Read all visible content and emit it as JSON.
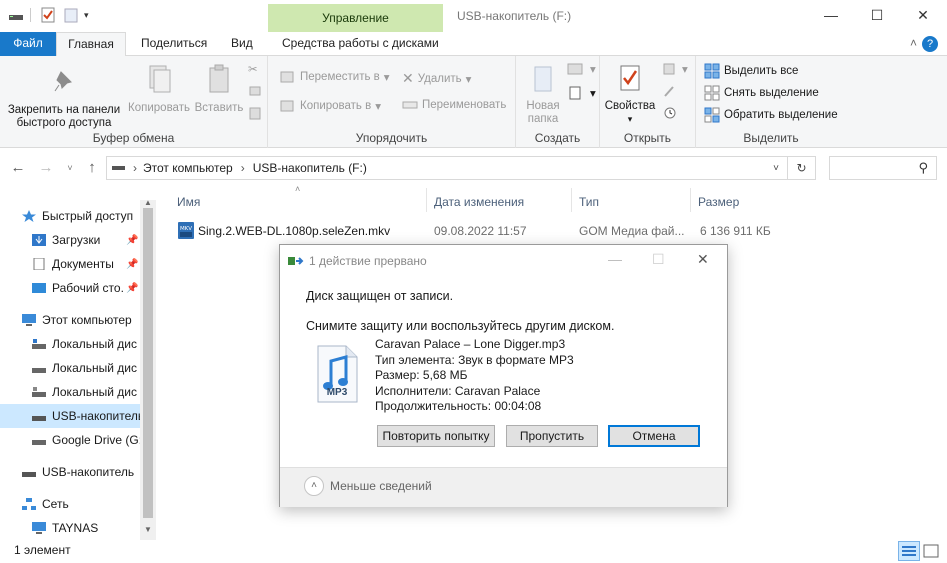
{
  "titlebar": {
    "context_tab_header": "Управление",
    "window_title": "USB-накопитель (F:)",
    "minimize": "—",
    "maximize": "☐",
    "close": "✕"
  },
  "tabs": {
    "file": "Файл",
    "home": "Главная",
    "share": "Поделиться",
    "view": "Вид",
    "drive_tools": "Средства работы с дисками",
    "collapse": "˄",
    "help": "?"
  },
  "ribbon": {
    "clipboard": {
      "pin_label": "Закрепить на панели быстрого доступа",
      "pin_line1": "Закрепить на панели",
      "pin_line2": "быстрого доступа",
      "copy": "Копировать",
      "paste": "Вставить",
      "group": "Буфер обмена"
    },
    "organize": {
      "move_to": "Переместить в",
      "copy_to": "Копировать в",
      "delete": "Удалить",
      "rename": "Переименовать",
      "group": "Упорядочить"
    },
    "new": {
      "new_folder_line1": "Новая",
      "new_folder_line2": "папка",
      "group": "Создать"
    },
    "open": {
      "properties": "Свойства",
      "group": "Открыть"
    },
    "select": {
      "select_all": "Выделить все",
      "select_none": "Снять выделение",
      "invert": "Обратить выделение",
      "group": "Выделить"
    }
  },
  "address": {
    "crumb_pc": "Этот компьютер",
    "crumb_sep": "›",
    "crumb_drive": "USB-накопитель (F:)",
    "search_placeholder": ""
  },
  "nav": {
    "items": [
      {
        "label": "Быстрый доступ"
      },
      {
        "label": "Загрузки"
      },
      {
        "label": "Документы"
      },
      {
        "label": "Рабочий сто."
      },
      {
        "label": "Этот компьютер"
      },
      {
        "label": "Локальный дис"
      },
      {
        "label": "Локальный дис"
      },
      {
        "label": "Локальный дис"
      },
      {
        "label": "USB-накопитель"
      },
      {
        "label": "Google Drive (G:"
      },
      {
        "label": "USB-накопитель"
      },
      {
        "label": "Сеть"
      },
      {
        "label": "TAYNAS"
      }
    ]
  },
  "filelist": {
    "columns": [
      "Имя",
      "Дата изменения",
      "Тип",
      "Размер"
    ],
    "rows": [
      {
        "name": "Sing.2.WEB-DL.1080p.seleZen.mkv",
        "date": "09.08.2022 11:57",
        "type": "GOM Медиа фай...",
        "size": "6 136 911 КБ"
      }
    ]
  },
  "status": {
    "count": "1 элемент"
  },
  "dialog": {
    "title": "1 действие прервано",
    "message1": "Диск защищен от записи.",
    "message2": "Снимите защиту или воспользуйтесь другим диском.",
    "file_icon_label": "MP3",
    "file": {
      "name": "Caravan Palace – Lone Digger.mp3",
      "type": "Тип элемента: Звук в формате MP3",
      "size": "Размер: 5,68 МБ",
      "artists": "Исполнители: Caravan Palace",
      "duration": "Продолжительность: 00:04:08"
    },
    "retry": "Повторить попытку",
    "skip": "Пропустить",
    "cancel": "Отмена",
    "less_details": "Меньше сведений"
  }
}
